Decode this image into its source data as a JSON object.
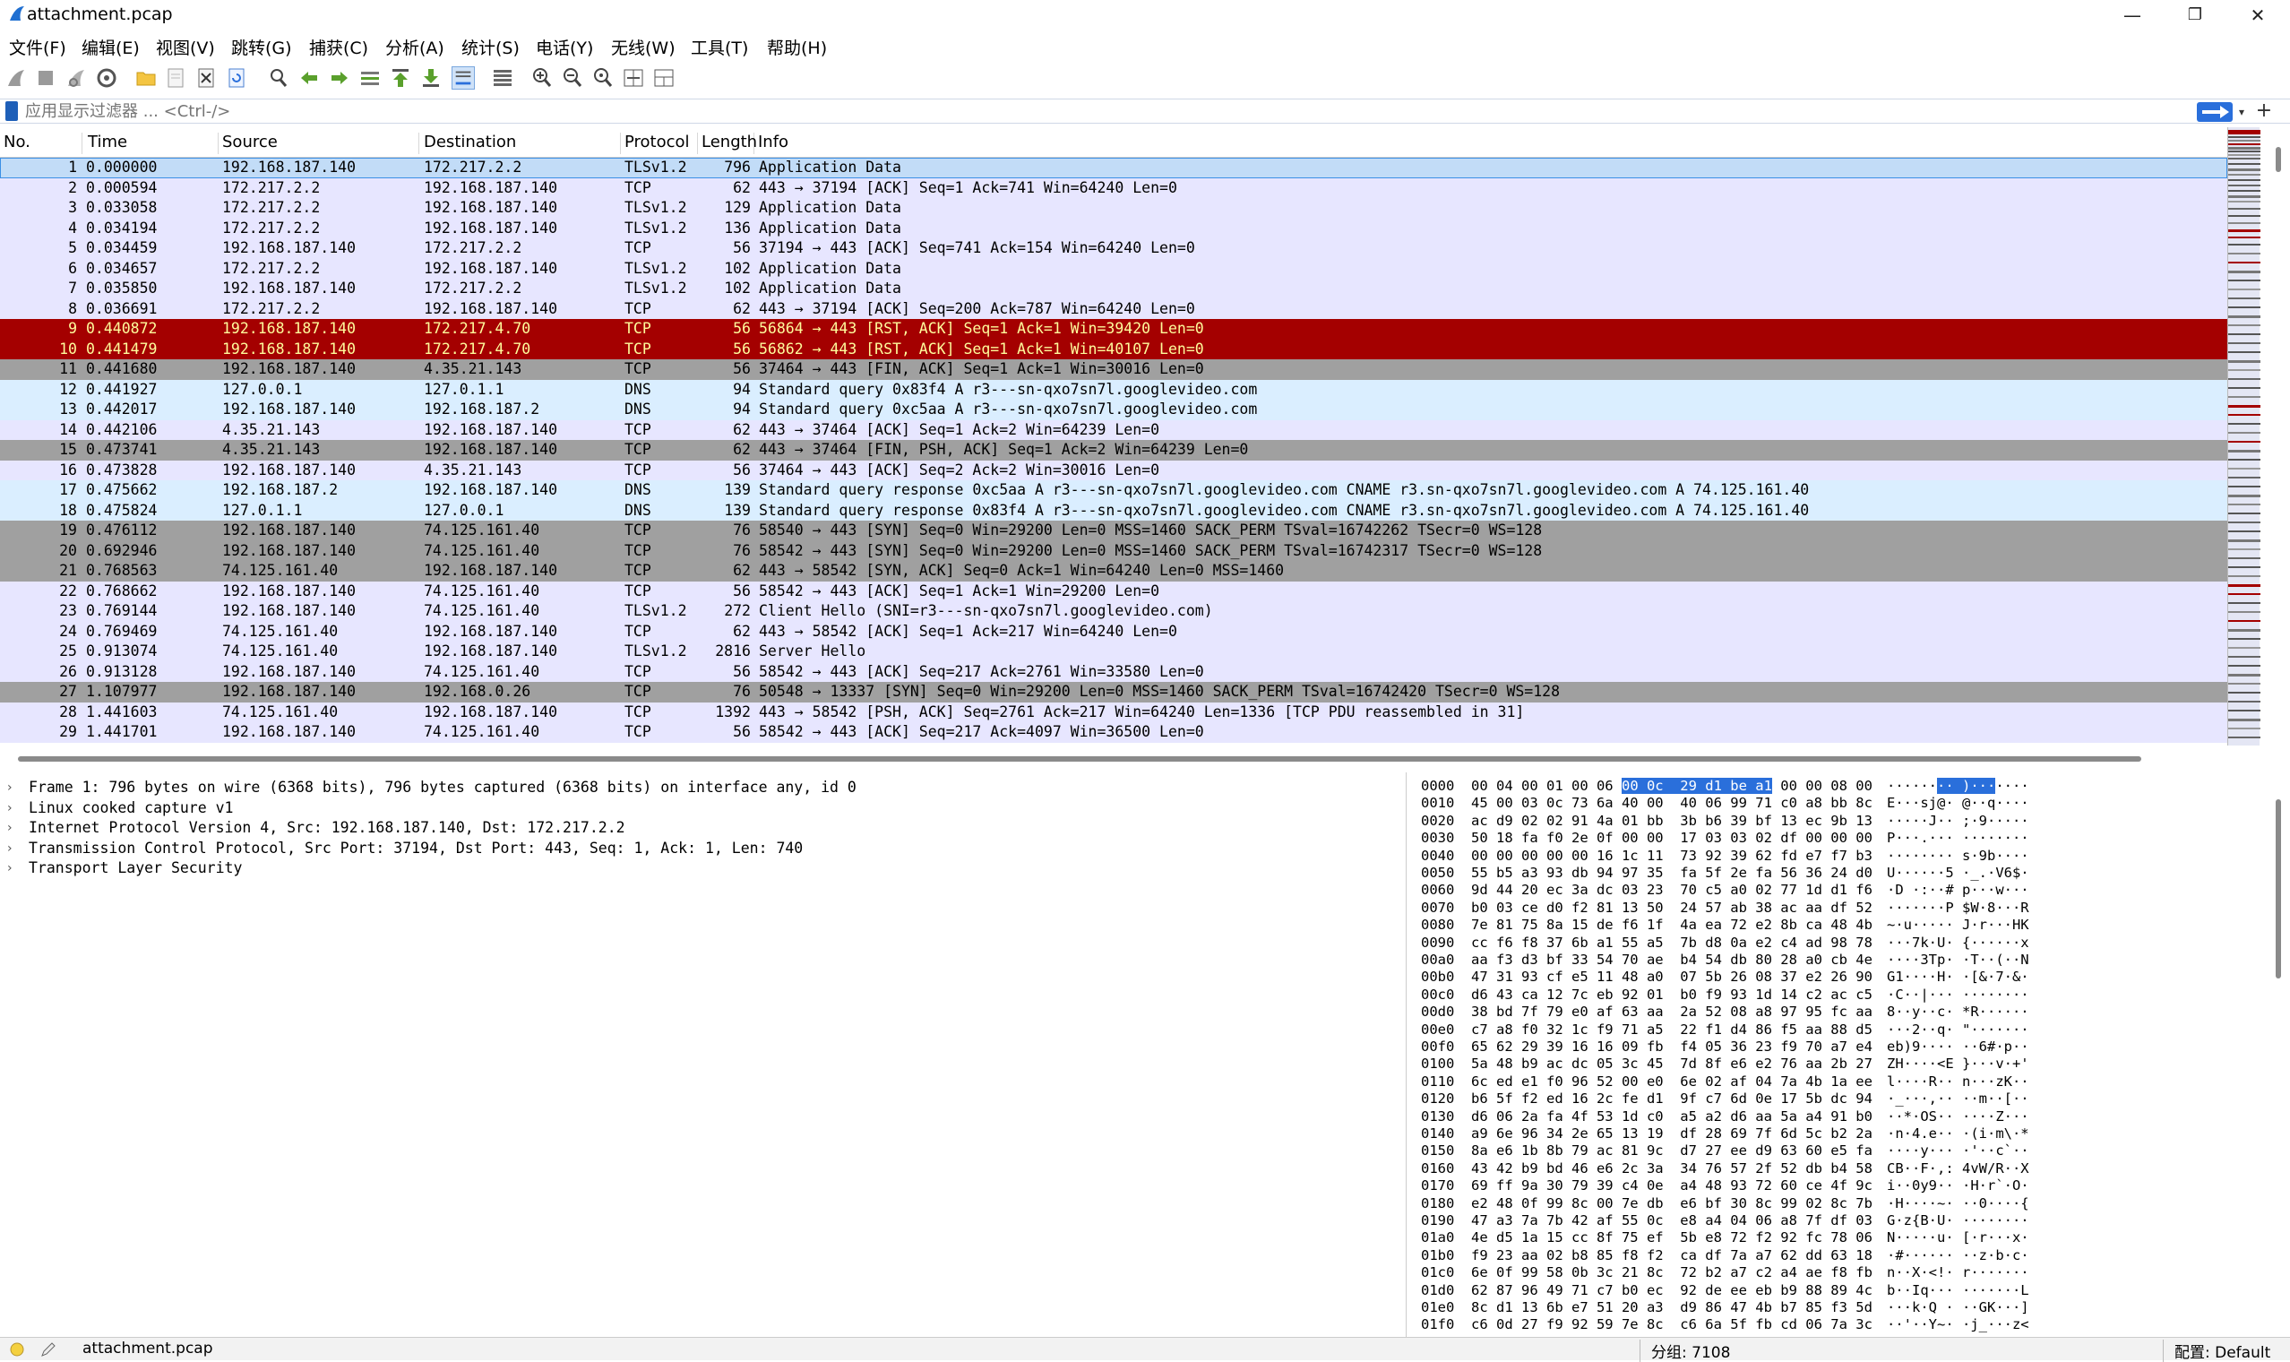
{
  "window": {
    "title": "attachment.pcap",
    "minimize": "—",
    "maximize": "❐",
    "close": "✕"
  },
  "menu": [
    "文件(F)",
    "编辑(E)",
    "视图(V)",
    "跳转(G)",
    "捕获(C)",
    "分析(A)",
    "统计(S)",
    "电话(Y)",
    "无线(W)",
    "工具(T)",
    "帮助(H)"
  ],
  "toolbar": {
    "icons": [
      "shark-fin-start-icon",
      "stop-square-icon",
      "restart-fin-icon",
      "capture-options-gear-icon",
      "open-folder-icon",
      "save-file-icon",
      "close-file-icon",
      "reload-icon",
      "find-magnifier-icon",
      "go-back-arrow-icon",
      "go-forward-arrow-icon",
      "go-to-packet-icon",
      "first-packet-icon",
      "last-packet-icon",
      "auto-scroll-icon",
      "colorize-icon",
      "zoom-in-icon",
      "zoom-out-icon",
      "zoom-normal-icon",
      "resize-columns-icon",
      "layout-icon"
    ]
  },
  "filter": {
    "placeholder": "应用显示过滤器 ... <Ctrl-/>",
    "plus": "+",
    "dropdown": "▾"
  },
  "columns": [
    "No.",
    "Time",
    "Source",
    "Destination",
    "Protocol",
    "Length",
    "Info"
  ],
  "colors": {
    "selected": "#c2dcf7",
    "selected_border": "#3b8fe5",
    "tcp": "#e7e6ff",
    "dns": "#daeeff",
    "rst": "#a40000",
    "rst_text": "#fffc9c",
    "fin_syn": "#a0a0a0",
    "tls_accent": "#2a6fdb"
  },
  "packets": [
    {
      "no": "1",
      "time": "0.000000",
      "src": "192.168.187.140",
      "dst": "172.217.2.2",
      "proto": "TLSv1.2",
      "len": "796",
      "info": "Application Data",
      "style": "selected"
    },
    {
      "no": "2",
      "time": "0.000594",
      "src": "172.217.2.2",
      "dst": "192.168.187.140",
      "proto": "TCP",
      "len": "62",
      "info": "443 → 37194 [ACK] Seq=1 Ack=741 Win=64240 Len=0",
      "style": "tcp"
    },
    {
      "no": "3",
      "time": "0.033058",
      "src": "172.217.2.2",
      "dst": "192.168.187.140",
      "proto": "TLSv1.2",
      "len": "129",
      "info": "Application Data",
      "style": "tcp"
    },
    {
      "no": "4",
      "time": "0.034194",
      "src": "172.217.2.2",
      "dst": "192.168.187.140",
      "proto": "TLSv1.2",
      "len": "136",
      "info": "Application Data",
      "style": "tcp"
    },
    {
      "no": "5",
      "time": "0.034459",
      "src": "192.168.187.140",
      "dst": "172.217.2.2",
      "proto": "TCP",
      "len": "56",
      "info": "37194 → 443 [ACK] Seq=741 Ack=154 Win=64240 Len=0",
      "style": "tcp"
    },
    {
      "no": "6",
      "time": "0.034657",
      "src": "172.217.2.2",
      "dst": "192.168.187.140",
      "proto": "TLSv1.2",
      "len": "102",
      "info": "Application Data",
      "style": "tcp"
    },
    {
      "no": "7",
      "time": "0.035850",
      "src": "192.168.187.140",
      "dst": "172.217.2.2",
      "proto": "TLSv1.2",
      "len": "102",
      "info": "Application Data",
      "style": "tcp"
    },
    {
      "no": "8",
      "time": "0.036691",
      "src": "172.217.2.2",
      "dst": "192.168.187.140",
      "proto": "TCP",
      "len": "62",
      "info": "443 → 37194 [ACK] Seq=200 Ack=787 Win=64240 Len=0",
      "style": "tcp"
    },
    {
      "no": "9",
      "time": "0.440872",
      "src": "192.168.187.140",
      "dst": "172.217.4.70",
      "proto": "TCP",
      "len": "56",
      "info": "56864 → 443 [RST, ACK] Seq=1 Ack=1 Win=39420 Len=0",
      "style": "rst"
    },
    {
      "no": "10",
      "time": "0.441479",
      "src": "192.168.187.140",
      "dst": "172.217.4.70",
      "proto": "TCP",
      "len": "56",
      "info": "56862 → 443 [RST, ACK] Seq=1 Ack=1 Win=40107 Len=0",
      "style": "rst"
    },
    {
      "no": "11",
      "time": "0.441680",
      "src": "192.168.187.140",
      "dst": "4.35.21.143",
      "proto": "TCP",
      "len": "56",
      "info": "37464 → 443 [FIN, ACK] Seq=1 Ack=1 Win=30016 Len=0",
      "style": "gray"
    },
    {
      "no": "12",
      "time": "0.441927",
      "src": "127.0.0.1",
      "dst": "127.0.1.1",
      "proto": "DNS",
      "len": "94",
      "info": "Standard query 0x83f4 A r3---sn-qxo7sn7l.googlevideo.com",
      "style": "dns"
    },
    {
      "no": "13",
      "time": "0.442017",
      "src": "192.168.187.140",
      "dst": "192.168.187.2",
      "proto": "DNS",
      "len": "94",
      "info": "Standard query 0xc5aa A r3---sn-qxo7sn7l.googlevideo.com",
      "style": "dns"
    },
    {
      "no": "14",
      "time": "0.442106",
      "src": "4.35.21.143",
      "dst": "192.168.187.140",
      "proto": "TCP",
      "len": "62",
      "info": "443 → 37464 [ACK] Seq=1 Ack=2 Win=64239 Len=0",
      "style": "tcp"
    },
    {
      "no": "15",
      "time": "0.473741",
      "src": "4.35.21.143",
      "dst": "192.168.187.140",
      "proto": "TCP",
      "len": "62",
      "info": "443 → 37464 [FIN, PSH, ACK] Seq=1 Ack=2 Win=64239 Len=0",
      "style": "gray"
    },
    {
      "no": "16",
      "time": "0.473828",
      "src": "192.168.187.140",
      "dst": "4.35.21.143",
      "proto": "TCP",
      "len": "56",
      "info": "37464 → 443 [ACK] Seq=2 Ack=2 Win=30016 Len=0",
      "style": "tcp"
    },
    {
      "no": "17",
      "time": "0.475662",
      "src": "192.168.187.2",
      "dst": "192.168.187.140",
      "proto": "DNS",
      "len": "139",
      "info": "Standard query response 0xc5aa A r3---sn-qxo7sn7l.googlevideo.com CNAME r3.sn-qxo7sn7l.googlevideo.com A 74.125.161.40",
      "style": "dns"
    },
    {
      "no": "18",
      "time": "0.475824",
      "src": "127.0.1.1",
      "dst": "127.0.0.1",
      "proto": "DNS",
      "len": "139",
      "info": "Standard query response 0x83f4 A r3---sn-qxo7sn7l.googlevideo.com CNAME r3.sn-qxo7sn7l.googlevideo.com A 74.125.161.40",
      "style": "dns"
    },
    {
      "no": "19",
      "time": "0.476112",
      "src": "192.168.187.140",
      "dst": "74.125.161.40",
      "proto": "TCP",
      "len": "76",
      "info": "58540 → 443 [SYN] Seq=0 Win=29200 Len=0 MSS=1460 SACK_PERM TSval=16742262 TSecr=0 WS=128",
      "style": "gray"
    },
    {
      "no": "20",
      "time": "0.692946",
      "src": "192.168.187.140",
      "dst": "74.125.161.40",
      "proto": "TCP",
      "len": "76",
      "info": "58542 → 443 [SYN] Seq=0 Win=29200 Len=0 MSS=1460 SACK_PERM TSval=16742317 TSecr=0 WS=128",
      "style": "gray"
    },
    {
      "no": "21",
      "time": "0.768563",
      "src": "74.125.161.40",
      "dst": "192.168.187.140",
      "proto": "TCP",
      "len": "62",
      "info": "443 → 58542 [SYN, ACK] Seq=0 Ack=1 Win=64240 Len=0 MSS=1460",
      "style": "gray"
    },
    {
      "no": "22",
      "time": "0.768662",
      "src": "192.168.187.140",
      "dst": "74.125.161.40",
      "proto": "TCP",
      "len": "56",
      "info": "58542 → 443 [ACK] Seq=1 Ack=1 Win=29200 Len=0",
      "style": "tcp"
    },
    {
      "no": "23",
      "time": "0.769144",
      "src": "192.168.187.140",
      "dst": "74.125.161.40",
      "proto": "TLSv1.2",
      "len": "272",
      "info": "Client Hello (SNI=r3---sn-qxo7sn7l.googlevideo.com)",
      "style": "tcp"
    },
    {
      "no": "24",
      "time": "0.769469",
      "src": "74.125.161.40",
      "dst": "192.168.187.140",
      "proto": "TCP",
      "len": "62",
      "info": "443 → 58542 [ACK] Seq=1 Ack=217 Win=64240 Len=0",
      "style": "tcp"
    },
    {
      "no": "25",
      "time": "0.913074",
      "src": "74.125.161.40",
      "dst": "192.168.187.140",
      "proto": "TLSv1.2",
      "len": "2816",
      "info": "Server Hello",
      "style": "tcp"
    },
    {
      "no": "26",
      "time": "0.913128",
      "src": "192.168.187.140",
      "dst": "74.125.161.40",
      "proto": "TCP",
      "len": "56",
      "info": "58542 → 443 [ACK] Seq=217 Ack=2761 Win=33580 Len=0",
      "style": "tcp"
    },
    {
      "no": "27",
      "time": "1.107977",
      "src": "192.168.187.140",
      "dst": "192.168.0.26",
      "proto": "TCP",
      "len": "76",
      "info": "50548 → 13337 [SYN] Seq=0 Win=29200 Len=0 MSS=1460 SACK_PERM TSval=16742420 TSecr=0 WS=128",
      "style": "gray"
    },
    {
      "no": "28",
      "time": "1.441603",
      "src": "74.125.161.40",
      "dst": "192.168.187.140",
      "proto": "TCP",
      "len": "1392",
      "info": "443 → 58542 [PSH, ACK] Seq=2761 Ack=217 Win=64240 Len=1336 [TCP PDU reassembled in 31]",
      "style": "tcp"
    },
    {
      "no": "29",
      "time": "1.441701",
      "src": "192.168.187.140",
      "dst": "74.125.161.40",
      "proto": "TCP",
      "len": "56",
      "info": "58542 → 443 [ACK] Seq=217 Ack=4097 Win=36500 Len=0",
      "style": "tcp"
    }
  ],
  "details": [
    "Frame 1: 796 bytes on wire (6368 bits), 796 bytes captured (6368 bits) on interface any, id 0",
    "Linux cooked capture v1",
    "Internet Protocol Version 4, Src: 192.168.187.140, Dst: 172.217.2.2",
    "Transmission Control Protocol, Src Port: 37194, Dst Port: 443, Seq: 1, Ack: 1, Len: 740",
    "Transport Layer Security"
  ],
  "hex": [
    {
      "off": "0000",
      "pre": "00 04 00 01 00 06 ",
      "hl": "00 0c  29 d1 be a1",
      "post": " 00 00 08 00",
      "apre": "······",
      "ahl": "·· )···",
      "apost": "····"
    },
    {
      "off": "0010",
      "hex": "45 00 03 0c 73 6a 40 00  40 06 99 71 c0 a8 bb 8c",
      "ascii": "E···sj@· @··q····"
    },
    {
      "off": "0020",
      "hex": "ac d9 02 02 91 4a 01 bb  3b b6 39 bf 13 ec 9b 13",
      "ascii": "·····J·· ;·9·····"
    },
    {
      "off": "0030",
      "hex": "50 18 fa f0 2e 0f 00 00  17 03 03 02 df 00 00 00",
      "ascii": "P···.··· ········"
    },
    {
      "off": "0040",
      "hex": "00 00 00 00 00 16 1c 11  73 92 39 62 fd e7 f7 b3",
      "ascii": "········ s·9b····"
    },
    {
      "off": "0050",
      "hex": "55 b5 a3 93 db 94 97 35  fa 5f 2e fa 56 36 24 d0",
      "ascii": "U······5 ·_.·V6$·"
    },
    {
      "off": "0060",
      "hex": "9d 44 20 ec 3a dc 03 23  70 c5 a0 02 77 1d d1 f6",
      "ascii": "·D ·:··# p···w···"
    },
    {
      "off": "0070",
      "hex": "b0 03 ce d0 f2 81 13 50  24 57 ab 38 ac aa df 52",
      "ascii": "·······P $W·8···R"
    },
    {
      "off": "0080",
      "hex": "7e 81 75 8a 15 de f6 1f  4a ea 72 e2 8b ca 48 4b",
      "ascii": "~·u····· J·r···HK"
    },
    {
      "off": "0090",
      "hex": "cc f6 f8 37 6b a1 55 a5  7b d8 0a e2 c4 ad 98 78",
      "ascii": "···7k·U· {······x"
    },
    {
      "off": "00a0",
      "hex": "aa f3 d3 bf 33 54 70 ae  b4 54 db 80 28 a0 cb 4e",
      "ascii": "····3Tp· ·T··(··N"
    },
    {
      "off": "00b0",
      "hex": "47 31 93 cf e5 11 48 a0  07 5b 26 08 37 e2 26 90",
      "ascii": "G1····H· ·[&·7·&·"
    },
    {
      "off": "00c0",
      "hex": "d6 43 ca 12 7c eb 92 01  b0 f9 93 1d 14 c2 ac c5",
      "ascii": "·C··|··· ········"
    },
    {
      "off": "00d0",
      "hex": "38 bd 7f 79 e0 af 63 aa  2a 52 08 a8 97 95 fc aa",
      "ascii": "8··y··c· *R······"
    },
    {
      "off": "00e0",
      "hex": "c7 a8 f0 32 1c f9 71 a5  22 f1 d4 86 f5 aa 88 d5",
      "ascii": "···2··q· \"·······"
    },
    {
      "off": "00f0",
      "hex": "65 62 29 39 16 16 09 fb  f4 05 36 23 f9 70 a7 e4",
      "ascii": "eb)9···· ··6#·p··"
    },
    {
      "off": "0100",
      "hex": "5a 48 b9 ac dc 05 3c 45  7d 8f e6 e2 76 aa 2b 27",
      "ascii": "ZH····<E }···v·+'"
    },
    {
      "off": "0110",
      "hex": "6c ed e1 f0 96 52 00 e0  6e 02 af 04 7a 4b 1a ee",
      "ascii": "l····R·· n···zK··"
    },
    {
      "off": "0120",
      "hex": "b6 5f f2 ed 16 2c fe d1  9f c7 6d 0e 17 5b dc 94",
      "ascii": "·_···,·· ··m··[··"
    },
    {
      "off": "0130",
      "hex": "d6 06 2a fa 4f 53 1d c0  a5 a2 d6 aa 5a a4 91 b0",
      "ascii": "··*·OS·· ····Z···"
    },
    {
      "off": "0140",
      "hex": "a9 6e 96 34 2e 65 13 19  df 28 69 7f 6d 5c b2 2a",
      "ascii": "·n·4.e·· ·(i·m\\·*"
    },
    {
      "off": "0150",
      "hex": "8a e6 1b 8b 79 ac 81 9c  d7 27 ee d9 63 60 e5 fa",
      "ascii": "····y··· ·'··c`··"
    },
    {
      "off": "0160",
      "hex": "43 42 b9 bd 46 e6 2c 3a  34 76 57 2f 52 db b4 58",
      "ascii": "CB··F·,: 4vW/R··X"
    },
    {
      "off": "0170",
      "hex": "69 ff 9a 30 79 39 c4 0e  a4 48 93 72 60 ce 4f 9c",
      "ascii": "i··0y9·· ·H·r`·O·"
    },
    {
      "off": "0180",
      "hex": "e2 48 0f 99 8c 00 7e db  e6 bf 30 8c 99 02 8c 7b",
      "ascii": "·H····~· ··0····{"
    },
    {
      "off": "0190",
      "hex": "47 a3 7a 7b 42 af 55 0c  e8 a4 04 06 a8 7f df 03",
      "ascii": "G·z{B·U· ········"
    },
    {
      "off": "01a0",
      "hex": "4e d5 1a 15 cc 8f 75 ef  5b e8 72 f2 92 fc 78 06",
      "ascii": "N·····u· [·r···x·"
    },
    {
      "off": "01b0",
      "hex": "f9 23 aa 02 b8 85 f8 f2  ca df 7a a7 62 dd 63 18",
      "ascii": "·#······ ··z·b·c·"
    },
    {
      "off": "01c0",
      "hex": "6e 0f 99 58 0b 3c 21 8c  72 b2 a7 c2 a4 ae f8 fb",
      "ascii": "n··X·<!· r·······"
    },
    {
      "off": "01d0",
      "hex": "62 87 96 49 71 c7 b0 ec  92 de ee eb b9 88 89 4c",
      "ascii": "b··Iq··· ·······L"
    },
    {
      "off": "01e0",
      "hex": "8c d1 13 6b e7 51 20 a3  d9 86 47 4b b7 85 f3 5d",
      "ascii": "···k·Q · ··GK···]"
    },
    {
      "off": "01f0",
      "hex": "c6 0d 27 f9 92 59 7e 8c  c6 6a 5f fb cd 06 7a 3c",
      "ascii": "··'··Y~· ·j_···z<"
    }
  ],
  "status": {
    "file": "attachment.pcap",
    "packets": "分组: 7108",
    "profile": "配置: Default"
  }
}
